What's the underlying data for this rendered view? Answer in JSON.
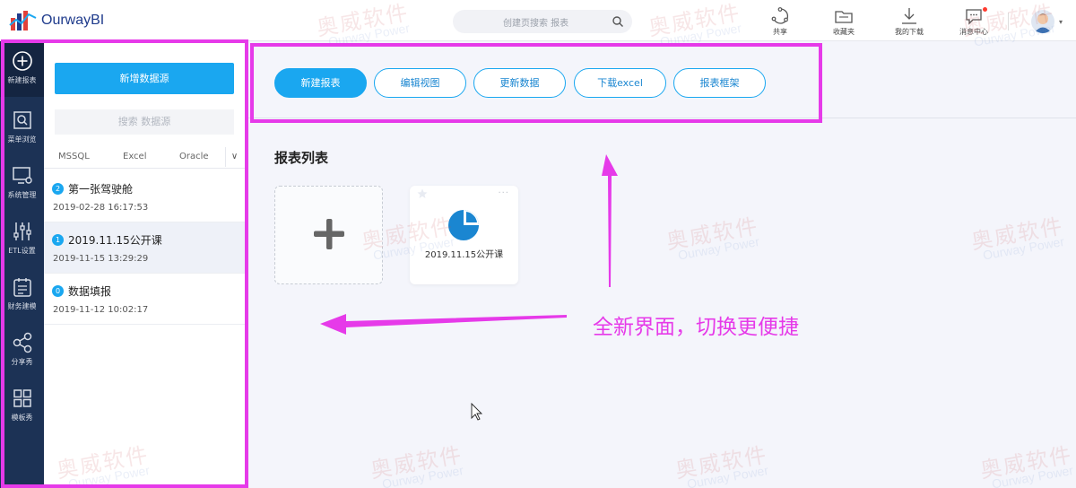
{
  "app": {
    "name": "OurwayBI"
  },
  "header": {
    "search_placeholder": "创建页搜索 报表",
    "buttons": [
      {
        "label": "共享",
        "icon": "share-icon"
      },
      {
        "label": "收藏夹",
        "icon": "favorites-icon"
      },
      {
        "label": "我的下载",
        "icon": "download-icon"
      },
      {
        "label": "消息中心",
        "icon": "message-icon"
      }
    ]
  },
  "rail": {
    "items": [
      {
        "label": "新建报表",
        "icon": "plus-circle-icon"
      },
      {
        "label": "菜单浏览",
        "icon": "search-window-icon"
      },
      {
        "label": "系统管理",
        "icon": "monitor-gear-icon"
      },
      {
        "label": "ETL设置",
        "icon": "sliders-icon"
      },
      {
        "label": "财务建模",
        "icon": "list-calendar-icon"
      },
      {
        "label": "分享秀",
        "icon": "share-nodes-icon"
      },
      {
        "label": "模板秀",
        "icon": "grid-icon"
      }
    ]
  },
  "panel": {
    "new_datasource": "新增数据源",
    "search_datasource": "搜索 数据源",
    "tabs": [
      "MSSQL",
      "Excel",
      "Oracle"
    ],
    "more": "∨",
    "reports": [
      {
        "badge": "2",
        "title": "第一张驾驶舱",
        "time": "2019-02-28 16:17:53"
      },
      {
        "badge": "1",
        "title": "2019.11.15公开课",
        "time": "2019-11-15 13:29:29"
      },
      {
        "badge": "0",
        "title": "数据填报",
        "time": "2019-11-12 10:02:17"
      }
    ]
  },
  "actions": [
    "新建报表",
    "编辑视图",
    "更新数据",
    "下载excel",
    "报表框架"
  ],
  "main": {
    "section_title": "报表列表",
    "cards": [
      {
        "label": "2019.11.15公开课",
        "icon": "pie-chart-icon",
        "more": "···"
      }
    ]
  },
  "annotation": {
    "caption": "全新界面，切换更便捷",
    "color": "#e63ae9"
  },
  "watermark": {
    "cn": "奥威软件",
    "en": "Ourway Power"
  },
  "colors": {
    "accent": "#1aa7f0",
    "rail": "#1c3255",
    "highlight": "#e63ae9"
  }
}
